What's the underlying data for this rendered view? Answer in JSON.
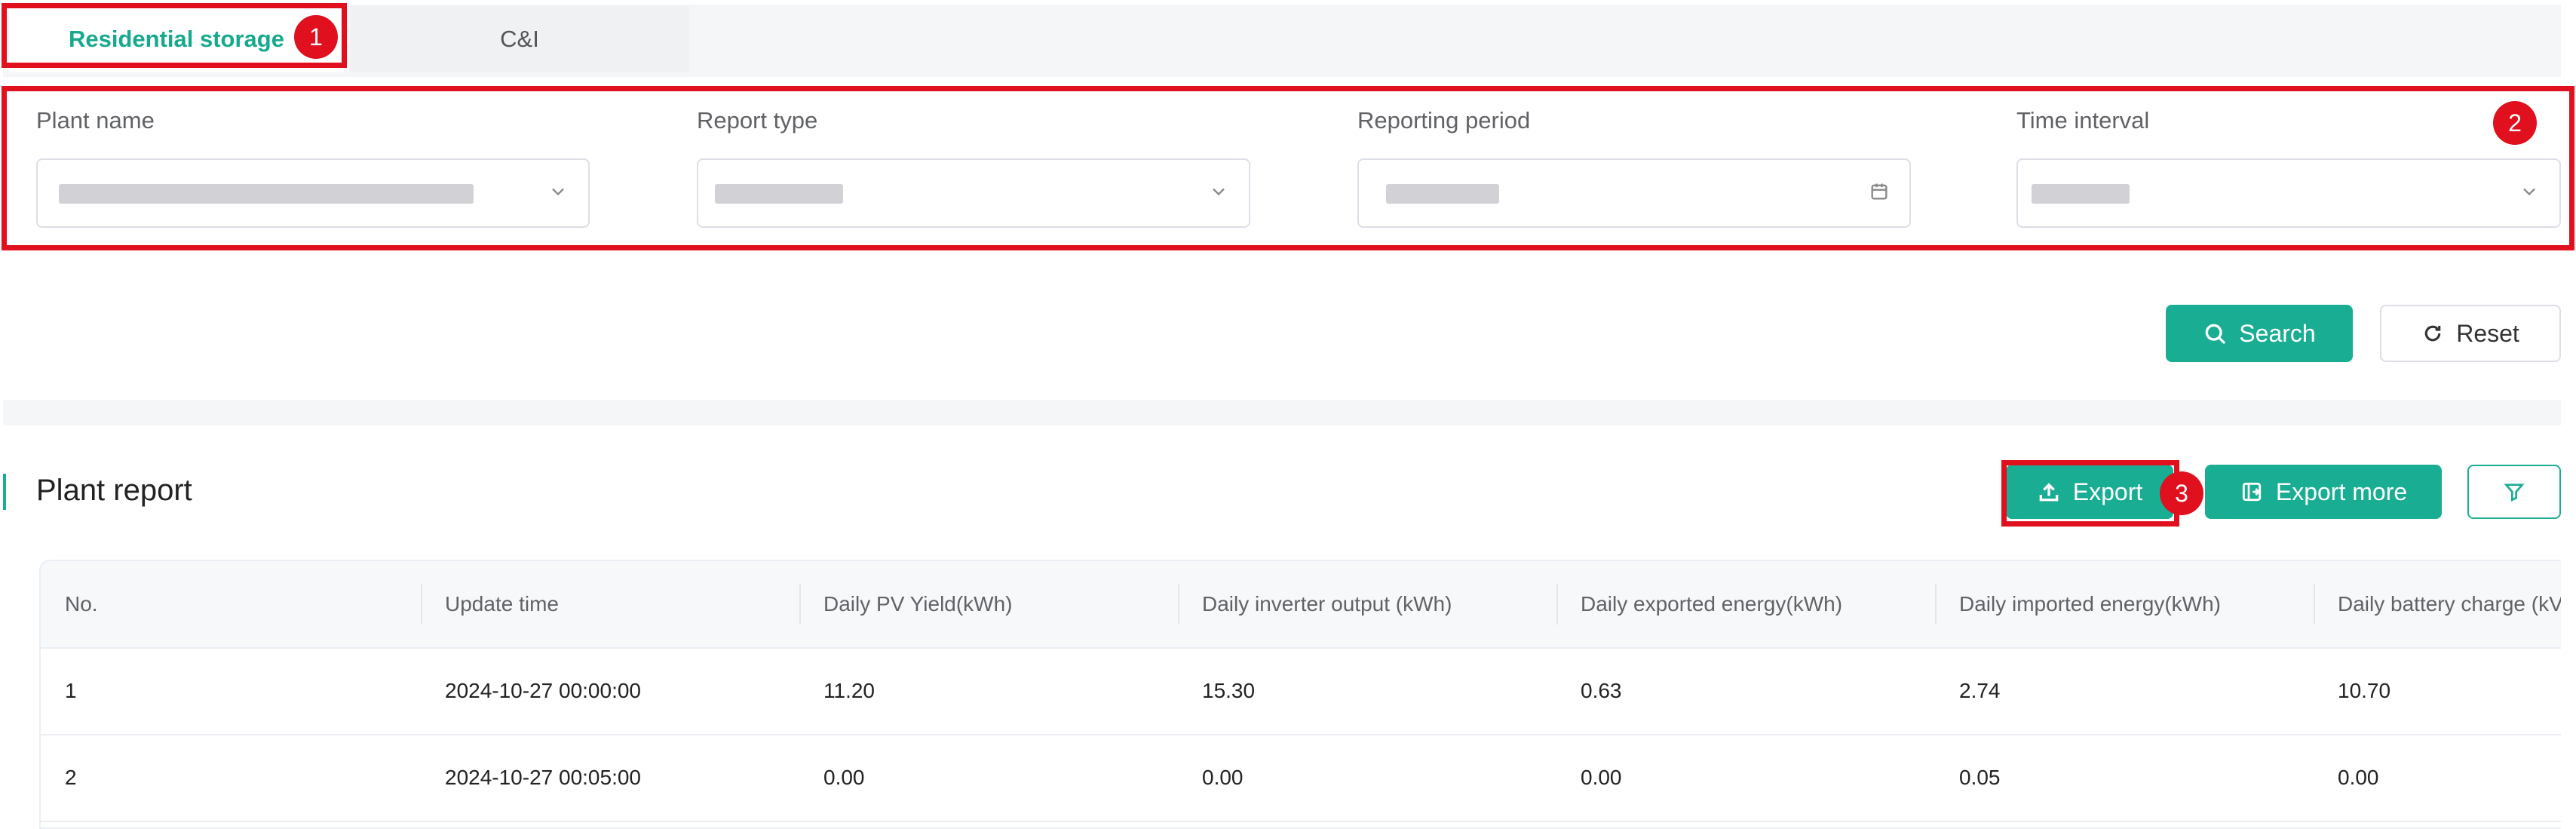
{
  "tabs": [
    {
      "label": "Residential storage",
      "active": true
    },
    {
      "label": "C&I",
      "active": false
    }
  ],
  "badges": {
    "one": "1",
    "two": "2",
    "three": "3"
  },
  "filters": {
    "plant_name": {
      "label": "Plant name"
    },
    "report_type": {
      "label": "Report type"
    },
    "reporting_period": {
      "label": "Reporting period"
    },
    "time_interval": {
      "label": "Time interval"
    }
  },
  "actions": {
    "search": "Search",
    "reset": "Reset"
  },
  "report": {
    "title": "Plant report",
    "export": "Export",
    "export_more": "Export more"
  },
  "table": {
    "headers": [
      "No.",
      "Update time",
      "Daily PV Yield(kWh)",
      "Daily inverter output (kWh)",
      "Daily exported energy(kWh)",
      "Daily imported energy(kWh)",
      "Daily battery charge (kV"
    ],
    "rows": [
      [
        "1",
        "2024-10-27 00:00:00",
        "11.20",
        "15.30",
        "0.63",
        "2.74",
        "10.70"
      ],
      [
        "2",
        "2024-10-27 00:05:00",
        "0.00",
        "0.00",
        "0.00",
        "0.05",
        "0.00"
      ]
    ]
  },
  "colors": {
    "accent": "#19ad93",
    "annotation": "#e0101e"
  }
}
